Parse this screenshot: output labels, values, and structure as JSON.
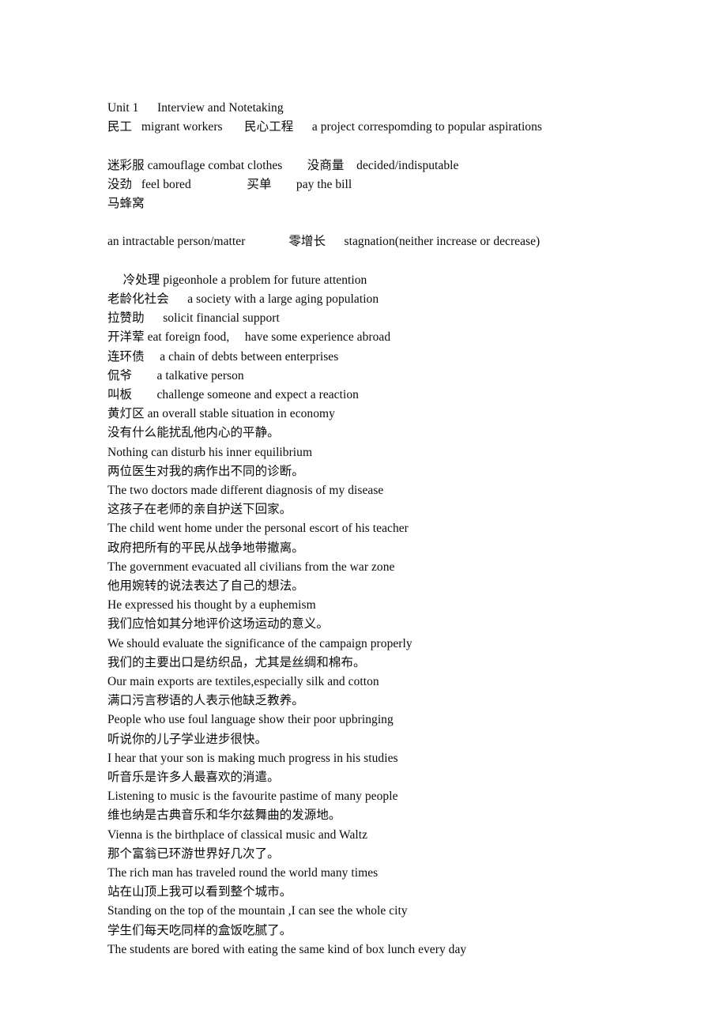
{
  "document": {
    "title": "Unit 1    Interview and Notetaking",
    "page_background": "#ffffff",
    "text_color": "#0a0a0a",
    "lines": [
      {
        "id": "l01",
        "text": "Unit 1      Interview and Notetaking"
      },
      {
        "id": "l02",
        "text": "民工   migrant workers       民心工程      a project correspomding to popular aspirations"
      },
      {
        "id": "l03",
        "text": ""
      },
      {
        "id": "l04",
        "text": "迷彩服 camouflage combat clothes        没商量    decided/indisputable"
      },
      {
        "id": "l05",
        "text": "没劲   feel bored                  买单        pay the bill"
      },
      {
        "id": "l06",
        "text": "马蜂窝"
      },
      {
        "id": "l07",
        "text": ""
      },
      {
        "id": "l08",
        "text": "an intractable person/matter              零增长      stagnation(neither increase or decrease)"
      },
      {
        "id": "l09",
        "text": ""
      },
      {
        "id": "l10",
        "text": "     冷处理 pigeonhole a problem for future attention"
      },
      {
        "id": "l11",
        "text": "老龄化社会      a society with a large aging population"
      },
      {
        "id": "l12",
        "text": "拉赞助      solicit financial support"
      },
      {
        "id": "l13",
        "text": "开洋荤 eat foreign food,     have some experience abroad"
      },
      {
        "id": "l14",
        "text": "连环债     a chain of debts between enterprises"
      },
      {
        "id": "l15",
        "text": "侃爷        a talkative person"
      },
      {
        "id": "l16",
        "text": "叫板        challenge someone and expect a reaction"
      },
      {
        "id": "l17",
        "text": "黄灯区 an overall stable situation in economy"
      },
      {
        "id": "l18",
        "text": "没有什么能扰乱他内心的平静。"
      },
      {
        "id": "l19",
        "text": "Nothing can disturb his inner equilibrium"
      },
      {
        "id": "l20",
        "text": "两位医生对我的病作出不同的诊断。"
      },
      {
        "id": "l21",
        "text": "The two doctors made different diagnosis of my disease"
      },
      {
        "id": "l22",
        "text": "这孩子在老师的亲自护送下回家。"
      },
      {
        "id": "l23",
        "text": "The child went home under the personal escort of his teacher"
      },
      {
        "id": "l24",
        "text": "政府把所有的平民从战争地带撤离。"
      },
      {
        "id": "l25",
        "text": "The government evacuated all civilians from the war zone"
      },
      {
        "id": "l26",
        "text": "他用婉转的说法表达了自己的想法。"
      },
      {
        "id": "l27",
        "text": "He expressed his thought by a euphemism"
      },
      {
        "id": "l28",
        "text": "我们应恰如其分地评价这场运动的意义。"
      },
      {
        "id": "l29",
        "text": "We should evaluate the significance of the campaign properly"
      },
      {
        "id": "l30",
        "text": "我们的主要出口是纺织品，尤其是丝绸和棉布。"
      },
      {
        "id": "l31",
        "text": "Our main exports are textiles,especially silk and cotton"
      },
      {
        "id": "l32",
        "text": "满口污言秽语的人表示他缺乏教养。"
      },
      {
        "id": "l33",
        "text": "People who use foul language show their poor upbringing"
      },
      {
        "id": "l34",
        "text": "听说你的儿子学业进步很快。"
      },
      {
        "id": "l35",
        "text": "I hear that your son is making much progress in his studies"
      },
      {
        "id": "l36",
        "text": "听音乐是许多人最喜欢的消遣。"
      },
      {
        "id": "l37",
        "text": "Listening to music is the favourite pastime of many people"
      },
      {
        "id": "l38",
        "text": "维也纳是古典音乐和华尔兹舞曲的发源地。"
      },
      {
        "id": "l39",
        "text": "Vienna is the birthplace of classical music and Waltz"
      },
      {
        "id": "l40",
        "text": "那个富翁已环游世界好几次了。"
      },
      {
        "id": "l41",
        "text": "The rich man has traveled round the world many times"
      },
      {
        "id": "l42",
        "text": "站在山顶上我可以看到整个城市。"
      },
      {
        "id": "l43",
        "text": "Standing on the top of the mountain ,I can see the whole city"
      },
      {
        "id": "l44",
        "text": "学生们每天吃同样的盒饭吃腻了。"
      },
      {
        "id": "l45",
        "text": "The students are bored with eating the same kind of box lunch every day"
      }
    ]
  }
}
